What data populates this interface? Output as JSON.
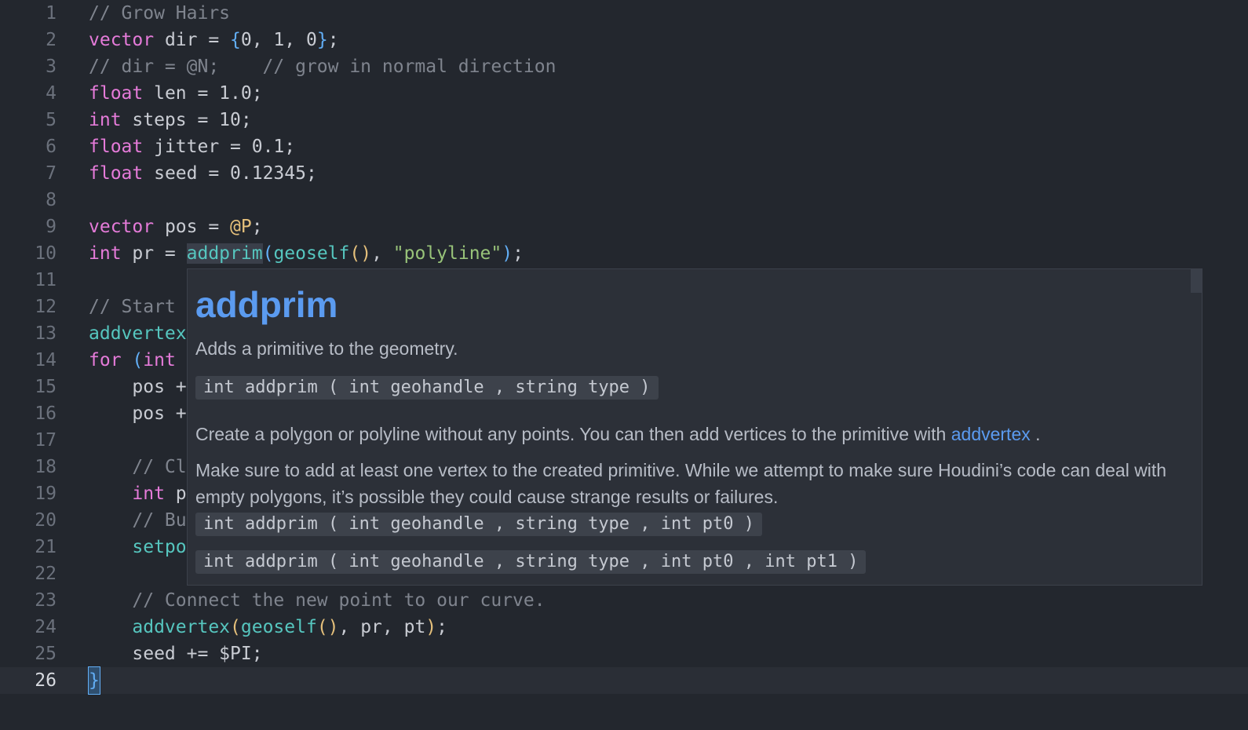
{
  "editor": {
    "current_line": "26",
    "lines": [
      {
        "n": "1",
        "tokens": [
          {
            "t": "// Grow Hairs",
            "c": "cmt"
          }
        ]
      },
      {
        "n": "2",
        "tokens": [
          {
            "t": "vector",
            "c": "kw"
          },
          {
            "t": " dir = "
          },
          {
            "t": "{",
            "c": "br1"
          },
          {
            "t": "0, 1, 0"
          },
          {
            "t": "}",
            "c": "br1"
          },
          {
            "t": ";"
          }
        ]
      },
      {
        "n": "3",
        "tokens": [
          {
            "t": "// dir = @N;    // grow in normal direction",
            "c": "cmt"
          }
        ]
      },
      {
        "n": "4",
        "tokens": [
          {
            "t": "float",
            "c": "kw"
          },
          {
            "t": " len = 1.0;"
          }
        ]
      },
      {
        "n": "5",
        "tokens": [
          {
            "t": "int",
            "c": "kw"
          },
          {
            "t": " steps = 10;"
          }
        ]
      },
      {
        "n": "6",
        "tokens": [
          {
            "t": "float",
            "c": "kw"
          },
          {
            "t": " jitter = 0.1;"
          }
        ]
      },
      {
        "n": "7",
        "tokens": [
          {
            "t": "float",
            "c": "kw"
          },
          {
            "t": " seed = 0.12345;"
          }
        ]
      },
      {
        "n": "8",
        "tokens": []
      },
      {
        "n": "9",
        "tokens": [
          {
            "t": "vector",
            "c": "kw"
          },
          {
            "t": " pos = "
          },
          {
            "t": "@P",
            "c": "attr"
          },
          {
            "t": ";"
          }
        ]
      },
      {
        "n": "10",
        "tokens": [
          {
            "t": "int",
            "c": "kw"
          },
          {
            "t": " pr = "
          },
          {
            "t": "addprim",
            "c": "fn hl"
          },
          {
            "t": "(",
            "c": "br1"
          },
          {
            "t": "geoself",
            "c": "fn"
          },
          {
            "t": "()",
            "c": "br2"
          },
          {
            "t": ", "
          },
          {
            "t": "\"polyline\"",
            "c": "str"
          },
          {
            "t": ")",
            "c": "br1"
          },
          {
            "t": ";"
          }
        ]
      },
      {
        "n": "11",
        "tokens": []
      },
      {
        "n": "12",
        "tokens": [
          {
            "t": "// Start",
            "c": "cmt"
          }
        ]
      },
      {
        "n": "13",
        "tokens": [
          {
            "t": "addvertex",
            "c": "fn"
          }
        ]
      },
      {
        "n": "14",
        "tokens": [
          {
            "t": "for",
            "c": "kw"
          },
          {
            "t": " "
          },
          {
            "t": "(",
            "c": "br1"
          },
          {
            "t": "int",
            "c": "kw"
          }
        ]
      },
      {
        "n": "15",
        "tokens": [
          {
            "t": "    pos +"
          }
        ]
      },
      {
        "n": "16",
        "tokens": [
          {
            "t": "    pos +"
          }
        ]
      },
      {
        "n": "17",
        "tokens": []
      },
      {
        "n": "18",
        "tokens": [
          {
            "t": "    // Cl",
            "c": "cmt"
          }
        ]
      },
      {
        "n": "19",
        "tokens": [
          {
            "t": "    "
          },
          {
            "t": "int",
            "c": "kw"
          },
          {
            "t": " p"
          }
        ]
      },
      {
        "n": "20",
        "tokens": [
          {
            "t": "    // Bu",
            "c": "cmt"
          }
        ]
      },
      {
        "n": "21",
        "tokens": [
          {
            "t": "    "
          },
          {
            "t": "setpo",
            "c": "fn"
          }
        ]
      },
      {
        "n": "22",
        "tokens": []
      },
      {
        "n": "23",
        "tokens": [
          {
            "t": "    // Connect the new point to our curve.",
            "c": "cmt"
          }
        ]
      },
      {
        "n": "24",
        "tokens": [
          {
            "t": "    "
          },
          {
            "t": "addvertex",
            "c": "fn"
          },
          {
            "t": "(",
            "c": "br2"
          },
          {
            "t": "geoself",
            "c": "fn"
          },
          {
            "t": "()",
            "c": "br2"
          },
          {
            "t": ", pr, pt"
          },
          {
            "t": ")",
            "c": "br2"
          },
          {
            "t": ";"
          }
        ]
      },
      {
        "n": "25",
        "tokens": [
          {
            "t": "    seed += $PI;"
          }
        ]
      },
      {
        "n": "26",
        "tokens": [
          {
            "t": "}",
            "c": "caret"
          }
        ]
      }
    ]
  },
  "tooltip": {
    "title": "addprim",
    "summary": "Adds a primitive to the geometry.",
    "signatures": [
      "int addprim ( int geohandle , string type )",
      "int addprim ( int geohandle , string type , int pt0 )",
      "int addprim ( int geohandle , string type , int pt0 , int pt1 )"
    ],
    "para1_before": "Create a polygon or polyline without any points. You can then add vertices to the primitive with ",
    "para1_link": "addvertex",
    "para1_after": " .",
    "para2": "Make sure to add at least one vertex to the created primitive. While we attempt to make sure Houdini’s code can deal with empty polygons, it’s possible they could cause strange results or failures."
  },
  "colors": {
    "background": "#23272e",
    "keyword": "#e57bd9",
    "function": "#56c6bf",
    "string": "#98c379",
    "comment": "#7f848e",
    "tooltip_title": "#5b9bf0"
  }
}
